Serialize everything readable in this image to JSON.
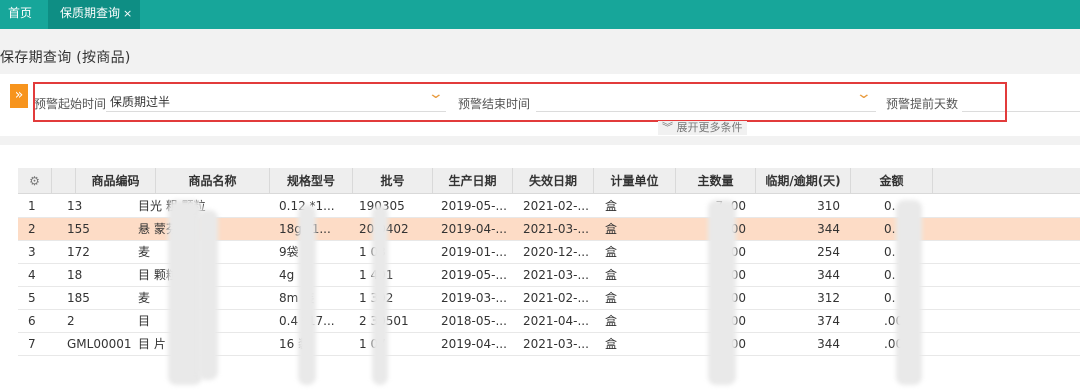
{
  "tabs": [
    {
      "label": "首页"
    },
    {
      "label": "保质期查询",
      "close": "×"
    }
  ],
  "page_title": "保存期查询 (按商品)",
  "filters": {
    "toggle_icon": "»",
    "start_label": "预警起始时间",
    "start_value": "保质期过半",
    "end_label": "预警结束时间",
    "end_value": "",
    "days_label": "预警提前天数",
    "expand_label": "展开更多条件",
    "expand_icon": "chevron-double-down-icon"
  },
  "table": {
    "settings_icon": "gear-icon",
    "headers": [
      "商品编码",
      "商品名称",
      "规格型号",
      "批号",
      "生产日期",
      "失效日期",
      "计量单位",
      "主数量",
      "临期/逾期(天)",
      "金额"
    ],
    "rows": [
      {
        "no": "1",
        "code": "13",
        "name": "目光  粗  颗粒",
        "spec": "0.12 *1...",
        "batch": "190305",
        "prod": "2019-05-...",
        "exp": "2021-02-...",
        "unit": "盒",
        "qty": "7 .00",
        "days": "310",
        "amount": "0."
      },
      {
        "no": "2",
        "code": "155",
        "name": "悬    蒙芬...",
        "spec": "18g *1...",
        "batch": "20 0402",
        "prod": "2019-04-...",
        "exp": "2021-03-...",
        "unit": "盒",
        "qty": "1 .00",
        "days": "344",
        "amount": "0."
      },
      {
        "no": "3",
        "code": "172",
        "name": "麦",
        "spec": "9袋",
        "batch": "1  03",
        "prod": "2019-01-...",
        "exp": "2020-12-...",
        "unit": "盒",
        "qty": ".00",
        "days": "254",
        "amount": "0."
      },
      {
        "no": "4",
        "code": "18",
        "name": "目   颗粒",
        "spec": "4g",
        "batch": "1 401",
        "prod": "2019-05-...",
        "exp": "2021-03-...",
        "unit": "盒",
        "qty": "2 .00",
        "days": "344",
        "amount": "0."
      },
      {
        "no": "5",
        "code": "185",
        "name": "麦",
        "spec": "8m  装",
        "batch": "1 302",
        "prod": "2019-03-...",
        "exp": "2021-02-...",
        "unit": "盒",
        "qty": ".00",
        "days": "312",
        "amount": "0."
      },
      {
        "no": "6",
        "code": "2",
        "name": "目",
        "spec": "0.4  *17...",
        "batch": "2 30501",
        "prod": "2018-05-...",
        "exp": "2021-04-...",
        "unit": "盒",
        "qty": ".00",
        "days": "374",
        "amount": ".00"
      },
      {
        "no": "7",
        "code": "GML00001",
        "name": "目   片",
        "spec": "16   装",
        "batch": "1 07",
        "prod": "2019-04-...",
        "exp": "2021-03-...",
        "unit": "盒",
        "qty": ".00",
        "days": "344",
        "amount": ".00"
      }
    ]
  },
  "colors": {
    "topbar": "#17a69a",
    "active_tab": "#0e8e84",
    "toggle": "#f7941d",
    "selected_row": "#fddcc6",
    "highlight_box": "#e23b3b"
  }
}
